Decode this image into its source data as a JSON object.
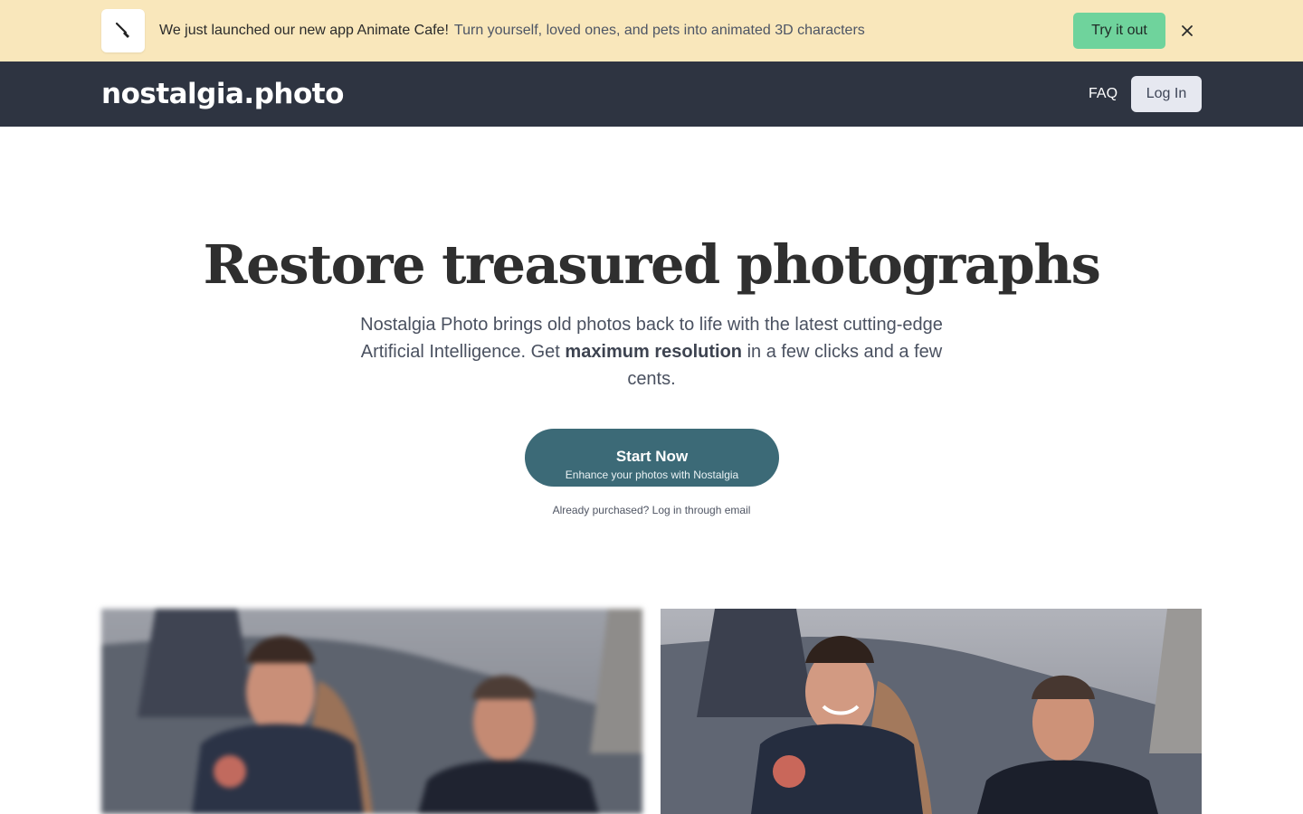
{
  "banner": {
    "icon": "paintbrush-icon",
    "headline": "We just launched our new app Animate Cafe!",
    "subtext": "Turn yourself, loved ones, and pets into animated 3D characters",
    "cta_label": "Try it out",
    "close_icon": "close-icon"
  },
  "navbar": {
    "logo": "nostalgia.photo",
    "faq_label": "FAQ",
    "login_label": "Log In"
  },
  "hero": {
    "title": "Restore treasured photographs",
    "desc_before": "Nostalgia Photo brings old photos back to life with the latest cutting-edge Artificial Intelligence. Get ",
    "desc_bold": "maximum resolution",
    "desc_after": " in a few clicks and a few cents.",
    "cta_main": "Start Now",
    "cta_sub": "Enhance your photos with Nostalgia",
    "already_text": "Already purchased? Log in through email"
  },
  "colors": {
    "banner_bg": "#f9e7bb",
    "navbar_bg": "#2e3441",
    "cta_bg": "#3c6a77",
    "try_btn_bg": "#6fd39c"
  }
}
